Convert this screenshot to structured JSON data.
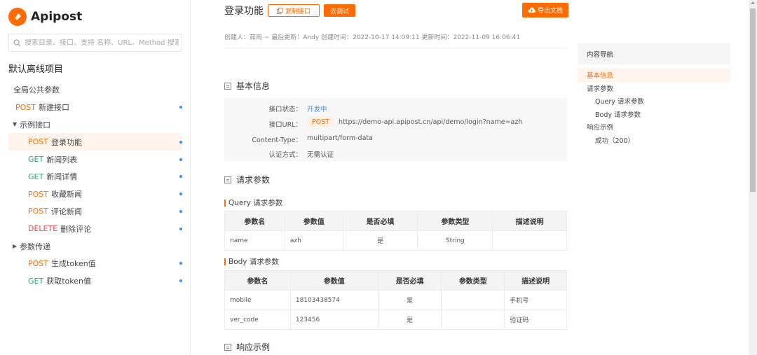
{
  "brand": {
    "name": "Apipost"
  },
  "search": {
    "placeholder": "搜索目录、接口。支持 名称、URL、Method 搜索"
  },
  "project": {
    "title": "默认离线项目"
  },
  "tree": [
    {
      "method": "",
      "label": "全局公共参数",
      "dot": false,
      "indent": 19
    },
    {
      "method": "POST",
      "mclass": "m-post",
      "label": "新建接口",
      "dot": true,
      "indent": 22
    },
    {
      "folder": true,
      "caret": "▼",
      "label": "示例接口",
      "indent": 18
    },
    {
      "method": "POST",
      "mclass": "m-post",
      "label": "登录功能",
      "dot": true,
      "indent": 40,
      "active": true
    },
    {
      "method": "GET",
      "mclass": "m-get",
      "label": "新闻列表",
      "dot": true,
      "indent": 40
    },
    {
      "method": "GET",
      "mclass": "m-get",
      "label": "新闻详情",
      "dot": true,
      "indent": 40
    },
    {
      "method": "POST",
      "mclass": "m-post",
      "label": "收藏新闻",
      "dot": true,
      "indent": 40
    },
    {
      "method": "POST",
      "mclass": "m-post",
      "label": "评论新闻",
      "dot": true,
      "indent": 40
    },
    {
      "method": "DELETE",
      "mclass": "m-delete",
      "label": "删除评论",
      "dot": true,
      "indent": 40
    },
    {
      "folder": true,
      "caret": "▶",
      "label": "参数传递",
      "indent": 18
    },
    {
      "method": "POST",
      "mclass": "m-post",
      "label": "生成token值",
      "dot": true,
      "indent": 40
    },
    {
      "method": "GET",
      "mclass": "m-get",
      "label": "获取token值",
      "dot": true,
      "indent": 40
    }
  ],
  "page": {
    "title": "登录功能",
    "copy_button": "复制接口",
    "debug_button": "去调试",
    "export_button": "导出文档",
    "meta": "创建人：茹雨 ~ 最后更新：Andy 创建时间：2022-10-17 14:09:11   更新时间：2022-11-09 16:06:41"
  },
  "basic": {
    "heading": "基本信息",
    "status_label": "接口状态：",
    "status_value": "开发中",
    "url_label": "接口URL：",
    "url_method": "POST",
    "url_value": "https://demo-api.apipost.cn/api/demo/login?name=azh",
    "content_type_label": "Content-Type：",
    "content_type_value": "multipart/form-data",
    "auth_label": "认证方式：",
    "auth_value": "无需认证"
  },
  "request": {
    "heading": "请求参数",
    "query_heading": "Query 请求参数",
    "query_columns": [
      "参数名",
      "参数值",
      "是否必填",
      "参数类型",
      "描述说明"
    ],
    "query_rows": [
      [
        "name",
        "azh",
        "是",
        "String",
        ""
      ]
    ],
    "body_heading": "Body 请求参数",
    "body_columns": [
      "参数名",
      "参数值",
      "是否必填",
      "参数类型",
      "描述说明"
    ],
    "body_rows": [
      [
        "mobile",
        "18103438574",
        "是",
        "",
        "手机号"
      ],
      [
        "ver_code",
        "123456",
        "是",
        "",
        "验证码"
      ]
    ]
  },
  "response": {
    "heading": "响应示例"
  },
  "toc": {
    "heading": "内容导航",
    "items": [
      {
        "label": "基本信息",
        "indent": 13,
        "active": true
      },
      {
        "label": "请求参数",
        "indent": 13
      },
      {
        "label": "Query 请求参数",
        "indent": 25
      },
      {
        "label": "Body 请求参数",
        "indent": 25
      },
      {
        "label": "响应示例",
        "indent": 13
      },
      {
        "label": "成功（200）",
        "indent": 25
      }
    ]
  },
  "colors": {
    "accent": "#ff6b00",
    "link": "#3c8ef5",
    "get": "#2ea36f",
    "delete": "#e84a4a"
  }
}
